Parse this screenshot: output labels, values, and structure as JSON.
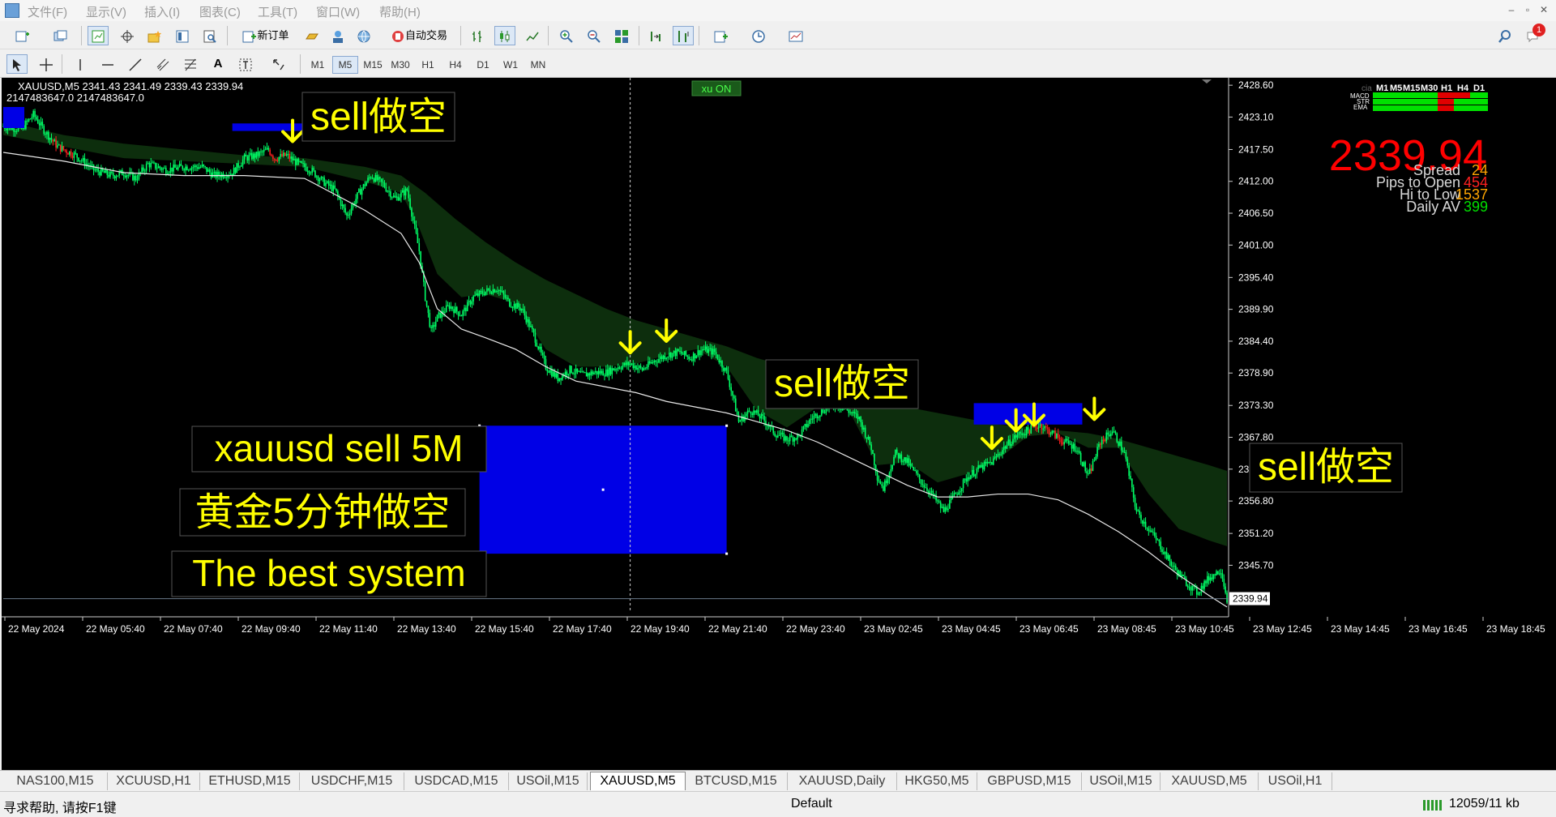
{
  "menu": [
    "文件(F)",
    "显示(V)",
    "插入(I)",
    "图表(C)",
    "工具(T)",
    "窗口(W)",
    "帮助(H)"
  ],
  "toolbar": {
    "new_order": "新订单",
    "auto_trading": "自动交易",
    "timeframes": [
      "M1",
      "M5",
      "M15",
      "M30",
      "H1",
      "H4",
      "D1",
      "W1",
      "MN"
    ],
    "active_timeframe": "M5",
    "notification_count": "1"
  },
  "chart": {
    "symbol_line": "XAUUSD,M5  2341.43 2341.49 2339.43 2339.94",
    "second_line": "2147483647.0  2147483647.0",
    "xu_on": "xu ON",
    "big_price": "2339.94",
    "info": {
      "spread_label": "Spread",
      "spread_value": "24",
      "pips_label": "Pips to Open",
      "pips_value": "454",
      "hilo_label": "Hi to Low",
      "hilo_value": "1537",
      "daily_label": "Daily AV",
      "daily_value": "399"
    },
    "mtf": {
      "header_left": "cia",
      "tfs": [
        "M1",
        "M5",
        "M15",
        "M30",
        "H1",
        "H4",
        "D1"
      ],
      "rows": [
        "MACD",
        "STR",
        "EMA"
      ],
      "colors": {
        "up": "#00e000",
        "down": "#e00000"
      }
    },
    "annotations": {
      "sell1": "sell做空",
      "sell2": "sell做空",
      "sell3": "sell做空",
      "title1": "xauusd sell  5M",
      "title2": "黄金5分钟做空",
      "title3": "The best system"
    },
    "colors": {
      "bull": "#00ff66",
      "bear": "#ff2020",
      "band": "#0d2e0d",
      "ma": "#e8e8e8",
      "box": "#0000e6",
      "arrow": "#ffff00",
      "label_text": "#ffff00"
    }
  },
  "chart_data": {
    "type": "candlestick",
    "symbol": "XAUUSD",
    "timeframe": "M5",
    "last_price": 2339.94,
    "y_ticks": [
      2428.6,
      2423.1,
      2417.5,
      2412.0,
      2406.5,
      2401.0,
      2395.4,
      2389.9,
      2384.4,
      2378.9,
      2373.3,
      2367.8,
      2362.3,
      2356.8,
      2351.2,
      2345.7
    ],
    "ylim": [
      2338.2,
      2429.6
    ],
    "x_labels": [
      "22 May 2024",
      "22 May 05:40",
      "22 May 07:40",
      "22 May 09:40",
      "22 May 11:40",
      "22 May 13:40",
      "22 May 15:40",
      "22 May 17:40",
      "22 May 19:40",
      "22 May 21:40",
      "22 May 23:40",
      "23 May 02:45",
      "23 May 04:45",
      "23 May 06:45",
      "23 May 08:45",
      "23 May 10:45",
      "23 May 12:45",
      "23 May 14:45",
      "23 May 16:45",
      "23 May 18:45"
    ],
    "close_path": [
      [
        0,
        2421.5
      ],
      [
        3,
        2421.0
      ],
      [
        5,
        2423.5
      ],
      [
        7,
        2420.5
      ],
      [
        9,
        2418.0
      ],
      [
        12,
        2416.5
      ],
      [
        15,
        2414.0
      ],
      [
        18,
        2413.0
      ],
      [
        20,
        2413.5
      ],
      [
        22,
        2412.5
      ],
      [
        24,
        2415.0
      ],
      [
        27,
        2414.0
      ],
      [
        30,
        2414.5
      ],
      [
        33,
        2414.5
      ],
      [
        35,
        2413.0
      ],
      [
        38,
        2413.5
      ],
      [
        40,
        2416.0
      ],
      [
        42,
        2416.5
      ],
      [
        44,
        2417.5
      ],
      [
        45,
        2416.0
      ],
      [
        47,
        2416.5
      ],
      [
        49,
        2415.0
      ],
      [
        51,
        2414.0
      ],
      [
        53,
        2412.0
      ],
      [
        55,
        2410.5
      ],
      [
        57,
        2406.0
      ],
      [
        59,
        2410.0
      ],
      [
        61,
        2413.0
      ],
      [
        63,
        2411.5
      ],
      [
        65,
        2409.0
      ],
      [
        67,
        2410.5
      ],
      [
        69,
        2400.0
      ],
      [
        70,
        2392.0
      ],
      [
        71,
        2386.0
      ],
      [
        72,
        2388.5
      ],
      [
        74,
        2390.5
      ],
      [
        76,
        2389.0
      ],
      [
        78,
        2392.0
      ],
      [
        80,
        2393.0
      ],
      [
        82,
        2393.5
      ],
      [
        84,
        2391.0
      ],
      [
        86,
        2390.0
      ],
      [
        88,
        2385.5
      ],
      [
        90,
        2380.0
      ],
      [
        92,
        2378.0
      ],
      [
        94,
        2379.5
      ],
      [
        96,
        2378.5
      ],
      [
        98,
        2379.0
      ],
      [
        100,
        2379.0
      ],
      [
        102,
        2380.0
      ],
      [
        104,
        2380.5
      ],
      [
        106,
        2379.5
      ],
      [
        108,
        2381.0
      ],
      [
        110,
        2382.0
      ],
      [
        112,
        2382.5
      ],
      [
        114,
        2381.5
      ],
      [
        116,
        2383.0
      ],
      [
        118,
        2382.5
      ],
      [
        120,
        2379.0
      ],
      [
        121,
        2375.0
      ],
      [
        122,
        2370.5
      ],
      [
        124,
        2372.5
      ],
      [
        126,
        2371.0
      ],
      [
        128,
        2368.5
      ],
      [
        130,
        2367.5
      ],
      [
        132,
        2368.0
      ],
      [
        134,
        2371.0
      ],
      [
        136,
        2372.5
      ],
      [
        138,
        2373.5
      ],
      [
        140,
        2372.5
      ],
      [
        142,
        2371.0
      ],
      [
        144,
        2366.0
      ],
      [
        145,
        2361.0
      ],
      [
        146,
        2359.0
      ],
      [
        148,
        2365.0
      ],
      [
        150,
        2363.5
      ],
      [
        152,
        2360.5
      ],
      [
        154,
        2358.0
      ],
      [
        156,
        2355.0
      ],
      [
        158,
        2358.0
      ],
      [
        160,
        2361.0
      ],
      [
        162,
        2362.5
      ],
      [
        164,
        2363.5
      ],
      [
        166,
        2366.0
      ],
      [
        168,
        2368.0
      ],
      [
        170,
        2369.0
      ],
      [
        172,
        2370.0
      ],
      [
        174,
        2368.5
      ],
      [
        176,
        2367.0
      ],
      [
        178,
        2366.0
      ],
      [
        180,
        2361.0
      ],
      [
        182,
        2367.0
      ],
      [
        184,
        2369.0
      ],
      [
        186,
        2365.0
      ],
      [
        187,
        2360.0
      ],
      [
        188,
        2355.0
      ],
      [
        190,
        2352.0
      ],
      [
        192,
        2349.0
      ],
      [
        194,
        2345.5
      ],
      [
        196,
        2343.0
      ],
      [
        198,
        2341.0
      ],
      [
        200,
        2343.5
      ],
      [
        202,
        2345.0
      ],
      [
        203,
        2339.94
      ]
    ],
    "ma_path": [
      [
        0,
        2417.0
      ],
      [
        10,
        2415.5
      ],
      [
        20,
        2413.5
      ],
      [
        30,
        2413.0
      ],
      [
        40,
        2413.0
      ],
      [
        50,
        2412.5
      ],
      [
        60,
        2407.0
      ],
      [
        66,
        2403.0
      ],
      [
        69,
        2398.0
      ],
      [
        72,
        2390.0
      ],
      [
        76,
        2386.5
      ],
      [
        80,
        2385.0
      ],
      [
        85,
        2383.0
      ],
      [
        90,
        2380.0
      ],
      [
        95,
        2377.5
      ],
      [
        100,
        2376.5
      ],
      [
        105,
        2375.5
      ],
      [
        110,
        2374.0
      ],
      [
        115,
        2373.0
      ],
      [
        120,
        2372.0
      ],
      [
        125,
        2370.5
      ],
      [
        130,
        2369.0
      ],
      [
        135,
        2367.0
      ],
      [
        140,
        2364.5
      ],
      [
        145,
        2362.0
      ],
      [
        150,
        2359.5
      ],
      [
        155,
        2357.5
      ],
      [
        160,
        2357.5
      ],
      [
        165,
        2358.0
      ],
      [
        170,
        2358.0
      ],
      [
        175,
        2357.0
      ],
      [
        180,
        2354.5
      ],
      [
        185,
        2351.5
      ],
      [
        190,
        2348.0
      ],
      [
        195,
        2344.0
      ],
      [
        200,
        2340.5
      ],
      [
        203,
        2338.5
      ]
    ],
    "band_upper": [
      [
        0,
        2422.5
      ],
      [
        10,
        2420.0
      ],
      [
        20,
        2418.5
      ],
      [
        30,
        2417.5
      ],
      [
        40,
        2416.5
      ],
      [
        50,
        2416.0
      ],
      [
        60,
        2414.5
      ],
      [
        66,
        2413.0
      ],
      [
        70,
        2410.0
      ],
      [
        75,
        2405.5
      ],
      [
        80,
        2401.5
      ],
      [
        85,
        2398.0
      ],
      [
        90,
        2395.0
      ],
      [
        95,
        2392.5
      ],
      [
        100,
        2390.0
      ],
      [
        105,
        2388.0
      ],
      [
        110,
        2386.5
      ],
      [
        115,
        2385.0
      ],
      [
        120,
        2383.5
      ],
      [
        125,
        2381.5
      ],
      [
        130,
        2380.0
      ],
      [
        135,
        2378.0
      ],
      [
        140,
        2376.5
      ],
      [
        145,
        2374.5
      ],
      [
        150,
        2373.0
      ],
      [
        155,
        2372.0
      ],
      [
        160,
        2371.0
      ],
      [
        165,
        2370.0
      ],
      [
        170,
        2369.5
      ],
      [
        175,
        2369.0
      ],
      [
        180,
        2368.5
      ],
      [
        185,
        2367.5
      ],
      [
        190,
        2366.0
      ],
      [
        195,
        2364.5
      ],
      [
        200,
        2363.0
      ],
      [
        203,
        2362.0
      ]
    ],
    "band_lower": [
      [
        0,
        2420.0
      ],
      [
        10,
        2418.0
      ],
      [
        20,
        2416.0
      ],
      [
        30,
        2415.5
      ],
      [
        40,
        2415.0
      ],
      [
        50,
        2414.5
      ],
      [
        60,
        2412.0
      ],
      [
        66,
        2410.0
      ],
      [
        69,
        2404.0
      ],
      [
        72,
        2396.0
      ],
      [
        76,
        2392.0
      ],
      [
        80,
        2392.5
      ],
      [
        85,
        2391.0
      ],
      [
        90,
        2383.0
      ],
      [
        95,
        2380.0
      ],
      [
        100,
        2380.0
      ],
      [
        105,
        2380.5
      ],
      [
        110,
        2382.0
      ],
      [
        115,
        2383.0
      ],
      [
        120,
        2380.0
      ],
      [
        125,
        2372.5
      ],
      [
        130,
        2369.5
      ],
      [
        135,
        2373.0
      ],
      [
        140,
        2373.0
      ],
      [
        145,
        2363.0
      ],
      [
        150,
        2363.5
      ],
      [
        155,
        2360.0
      ],
      [
        160,
        2361.5
      ],
      [
        165,
        2364.0
      ],
      [
        170,
        2368.0
      ],
      [
        175,
        2368.5
      ],
      [
        180,
        2366.0
      ],
      [
        185,
        2366.0
      ],
      [
        190,
        2358.0
      ],
      [
        195,
        2352.0
      ],
      [
        200,
        2350.0
      ],
      [
        203,
        2349.0
      ]
    ],
    "sell_arrows": [
      [
        48,
        2417.5
      ],
      [
        104,
        2381.0
      ],
      [
        110,
        2383.0
      ],
      [
        164,
        2364.5
      ],
      [
        168,
        2367.5
      ],
      [
        171,
        2368.5
      ],
      [
        181,
        2369.5
      ]
    ],
    "zones": [
      {
        "x0": 38,
        "x1": 54,
        "y0": 2420.7,
        "y1": 2422.0
      },
      {
        "x0": 79,
        "x1": 120,
        "y0": 2347.7,
        "y1": 2369.8
      },
      {
        "x0": 161,
        "x1": 179,
        "y0": 2370.0,
        "y1": 2373.7
      }
    ],
    "vline_x": 104
  }
}
